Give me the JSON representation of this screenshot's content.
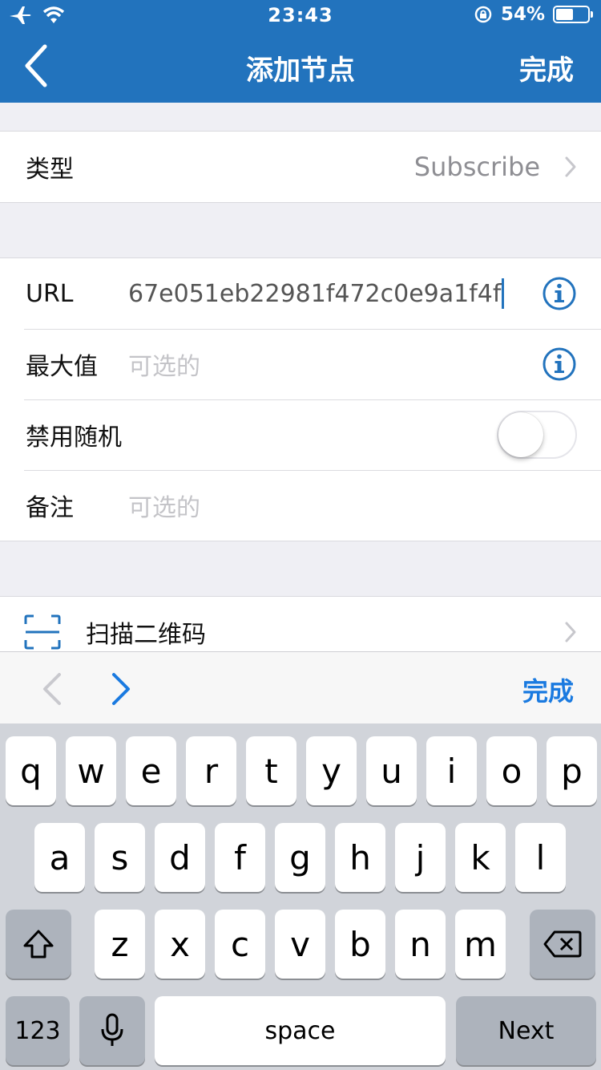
{
  "status_bar": {
    "time": "23:43",
    "battery_percent": "54%",
    "battery_level": 0.54
  },
  "nav": {
    "title": "添加节点",
    "done_label": "完成"
  },
  "type_row": {
    "label": "类型",
    "value": "Subscribe"
  },
  "form": {
    "url": {
      "label": "URL",
      "value": "67e051eb22981f472c0e9a1f4f"
    },
    "max": {
      "label": "最大值",
      "placeholder": "可选的"
    },
    "disable_random": {
      "label": "禁用随机",
      "enabled": false
    },
    "note": {
      "label": "备注",
      "placeholder": "可选的"
    }
  },
  "scan": {
    "label": "扫描二维码"
  },
  "accessory": {
    "done_label": "完成"
  },
  "keyboard": {
    "row1": [
      "q",
      "w",
      "e",
      "r",
      "t",
      "y",
      "u",
      "i",
      "o",
      "p"
    ],
    "row2": [
      "a",
      "s",
      "d",
      "f",
      "g",
      "h",
      "j",
      "k",
      "l"
    ],
    "row3": [
      "z",
      "x",
      "c",
      "v",
      "b",
      "n",
      "m"
    ],
    "numbers_label": "123",
    "space_label": "space",
    "next_label": "Next"
  },
  "colors": {
    "accent": "#2273bd",
    "link_blue": "#1a7ae0"
  }
}
